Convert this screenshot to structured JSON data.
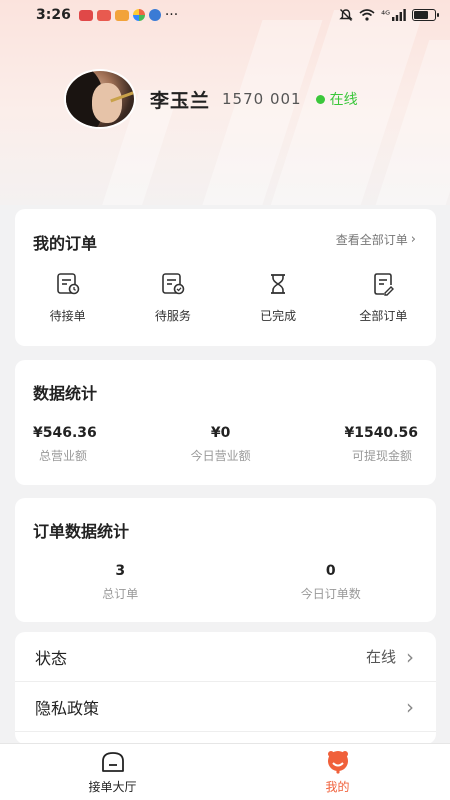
{
  "status_bar": {
    "time": "3:26",
    "dots": "···",
    "signal_label": "⁴ᴳ"
  },
  "profile": {
    "name": "李玉兰",
    "phone": "1570    001",
    "status": "在线"
  },
  "orders_card": {
    "title": "我的订单",
    "view_all": "查看全部订单",
    "items": [
      {
        "label": "待接单",
        "icon": "pending-order-icon"
      },
      {
        "label": "待服务",
        "icon": "to-serve-icon"
      },
      {
        "label": "已完成",
        "icon": "hourglass-icon"
      },
      {
        "label": "全部订单",
        "icon": "all-orders-icon"
      }
    ]
  },
  "stats_card": {
    "title": "数据统计",
    "items": [
      {
        "value": "¥546.36",
        "label": "总营业额"
      },
      {
        "value": "¥0",
        "label": "今日营业额"
      },
      {
        "value": "¥1540.56",
        "label": "可提现金额"
      }
    ]
  },
  "order_stats_card": {
    "title": "订单数据统计",
    "items": [
      {
        "value": "3",
        "label": "总订单"
      },
      {
        "value": "0",
        "label": "今日订单数"
      }
    ]
  },
  "menu": [
    {
      "label": "状态",
      "value": "在线"
    },
    {
      "label": "隐私政策",
      "value": ""
    }
  ],
  "tabbar": {
    "tabs": [
      {
        "label": "接单大厅",
        "icon": "home-icon",
        "active": false
      },
      {
        "label": "我的",
        "icon": "profile-icon",
        "active": true
      }
    ]
  },
  "colors": {
    "accent": "#f0603a",
    "online": "#3bc73b"
  }
}
